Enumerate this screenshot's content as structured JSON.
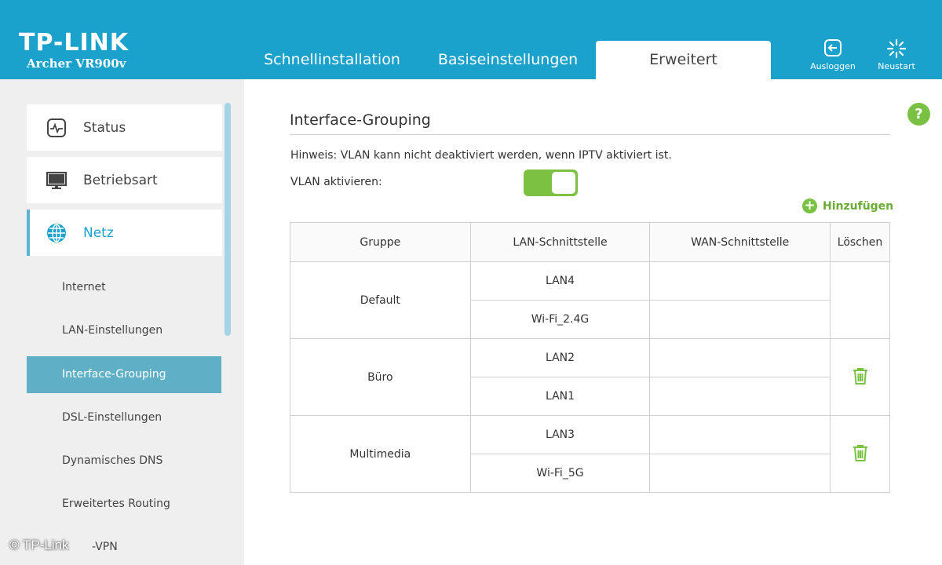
{
  "header": {
    "brand": "TP-LINK",
    "model": "Archer VR900v",
    "tabs": [
      {
        "label": "Schnellinstallation",
        "active": false
      },
      {
        "label": "Basiseinstellungen",
        "active": false
      },
      {
        "label": "Erweitert",
        "active": true
      }
    ],
    "logout_label": "Ausloggen",
    "restart_label": "Neustart"
  },
  "sidebar": {
    "main_items": [
      {
        "label": "Status",
        "icon": "pulse-monitor-icon"
      },
      {
        "label": "Betriebsart",
        "icon": "monitor-icon"
      },
      {
        "label": "Netz",
        "icon": "globe-icon",
        "active": true
      }
    ],
    "sub_items": [
      {
        "label": "Internet"
      },
      {
        "label": "LAN-Einstellungen"
      },
      {
        "label": "Interface-Grouping",
        "active": true
      },
      {
        "label": "DSL-Einstellungen"
      },
      {
        "label": "Dynamisches DNS"
      },
      {
        "label": "Erweitertes Routing"
      },
      {
        "label": "-VPN"
      }
    ]
  },
  "watermark": "© TP-Link",
  "main": {
    "title": "Interface-Grouping",
    "hint": "Hinweis: VLAN kann nicht deaktiviert werden, wenn IPTV aktiviert ist.",
    "vlan_label": "VLAN aktivieren:",
    "vlan_enabled": true,
    "add_label": "Hinzufügen",
    "help_label": "?",
    "table": {
      "headers": [
        "Gruppe",
        "LAN-Schnittstelle",
        "WAN-Schnittstelle",
        "Löschen"
      ],
      "groups": [
        {
          "name": "Default",
          "lan": [
            "LAN4",
            "Wi-Fi_2.4G"
          ],
          "wan": [
            "",
            ""
          ],
          "deletable": false
        },
        {
          "name": "Büro",
          "lan": [
            "LAN2",
            "LAN1"
          ],
          "wan": [
            "",
            ""
          ],
          "deletable": true
        },
        {
          "name": "Multimedia",
          "lan": [
            "LAN3",
            "Wi-Fi_5G"
          ],
          "wan": [
            "",
            ""
          ],
          "deletable": true
        }
      ]
    }
  },
  "colors": {
    "header_bg": "#1aa1cc",
    "accent_green": "#79c142",
    "active_subitem_bg": "#5fb0c7",
    "sidebar_bg": "#efefef"
  }
}
